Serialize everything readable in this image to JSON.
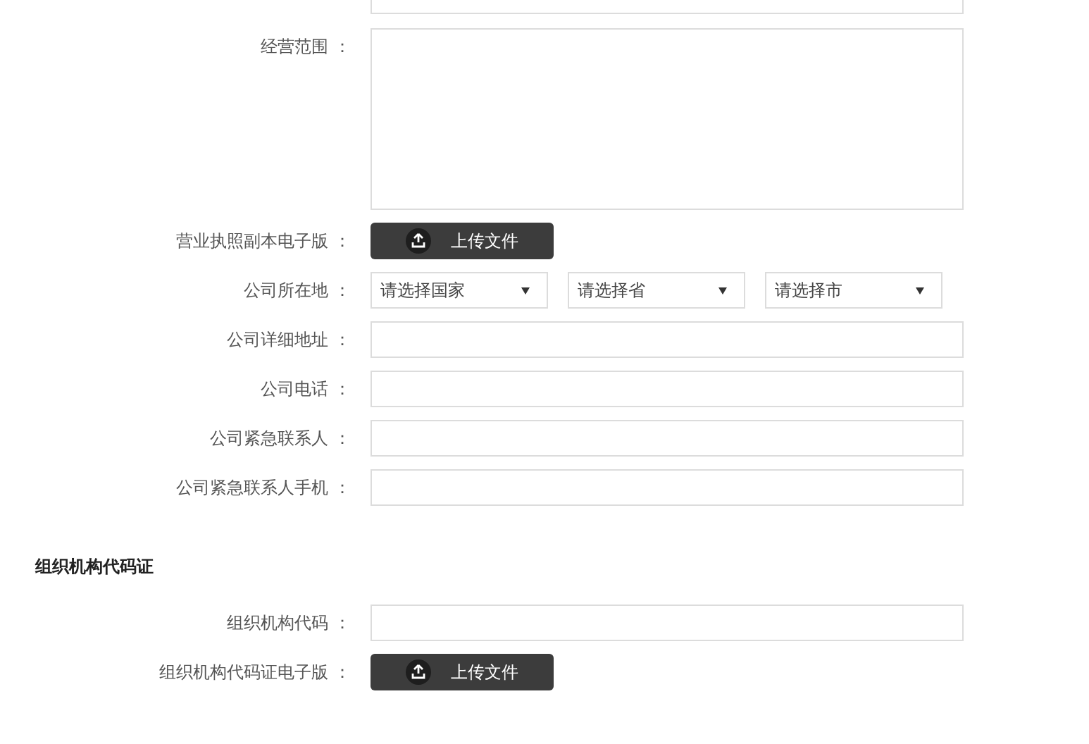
{
  "sections": [
    {
      "fields": [
        {
          "kind": "textarea",
          "label": "经营范围 ："
        },
        {
          "kind": "upload",
          "label": "营业执照副本电子版 ：",
          "button": "上传文件"
        },
        {
          "kind": "selects",
          "label": "公司所在地 ：",
          "selects": [
            "请选择国家",
            "请选择省",
            "请选择市"
          ]
        },
        {
          "kind": "input",
          "label": "公司详细地址 ："
        },
        {
          "kind": "input",
          "label": "公司电话 ："
        },
        {
          "kind": "input",
          "label": "公司紧急联系人 ："
        },
        {
          "kind": "input",
          "label": "公司紧急联系人手机 ："
        }
      ]
    },
    {
      "heading": "组织机构代码证",
      "fields": [
        {
          "kind": "input",
          "label": "组织机构代码 ："
        },
        {
          "kind": "upload",
          "label": "组织机构代码证电子版 ：",
          "button": "上传文件"
        }
      ]
    }
  ]
}
